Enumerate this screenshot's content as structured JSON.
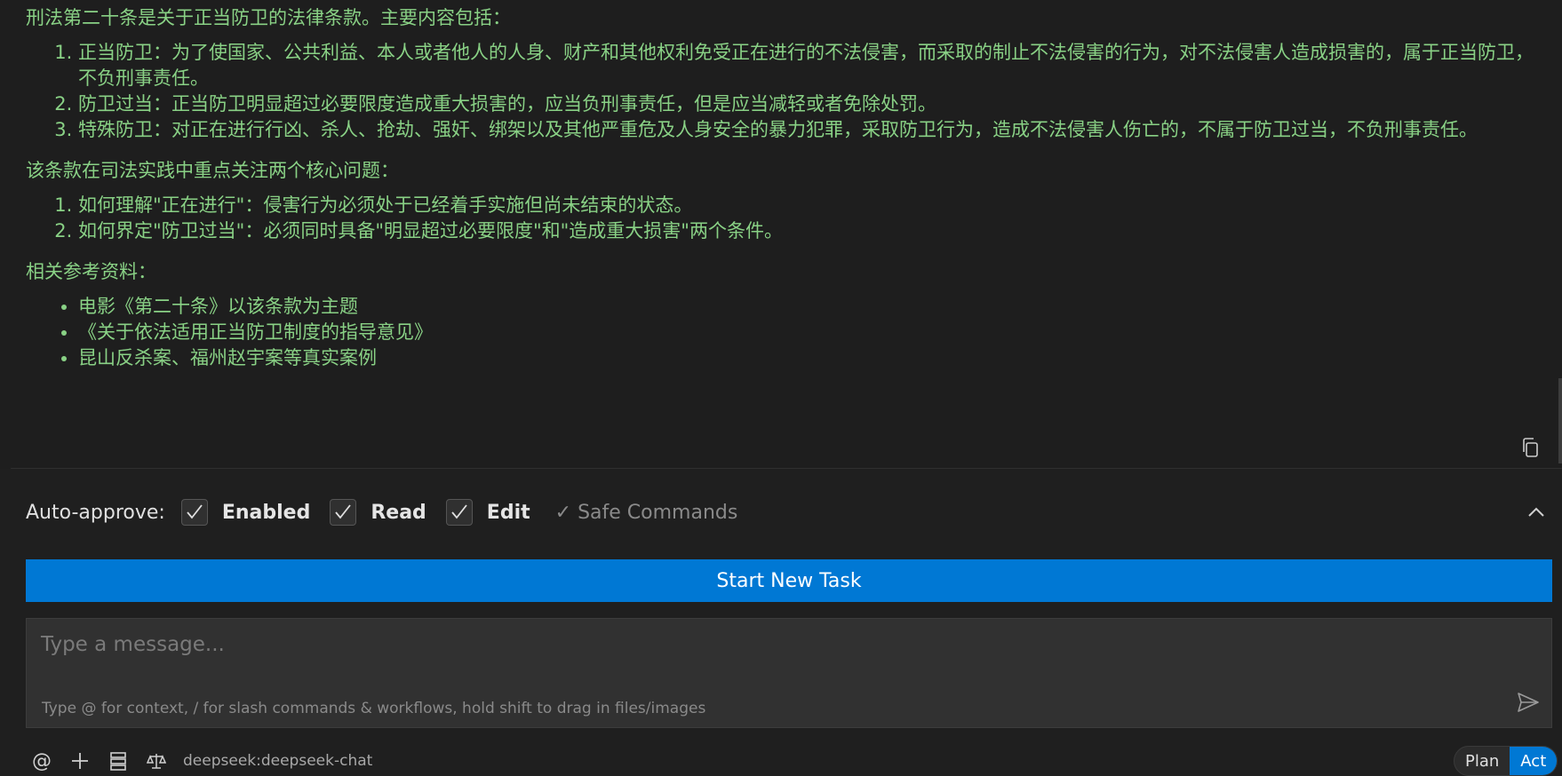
{
  "answer": {
    "intro": "刑法第二十条是关于正当防卫的法律条款。主要内容包括：",
    "main_points": [
      "正当防卫：为了使国家、公共利益、本人或者他人的人身、财产和其他权利免受正在进行的不法侵害，而采取的制止不法侵害的行为，对不法侵害人造成损害的，属于正当防卫，不负刑事责任。",
      "防卫过当：正当防卫明显超过必要限度造成重大损害的，应当负刑事责任，但是应当减轻或者免除处罚。",
      "特殊防卫：对正在进行行凶、杀人、抢劫、强奸、绑架以及其他严重危及人身安全的暴力犯罪，采取防卫行为，造成不法侵害人伤亡的，不属于防卫过当，不负刑事责任。"
    ],
    "practice_heading": "该条款在司法实践中重点关注两个核心问题：",
    "practice_points": [
      "如何理解\"正在进行\"：侵害行为必须处于已经着手实施但尚未结束的状态。",
      "如何界定\"防卫过当\"：必须同时具备\"明显超过必要限度\"和\"造成重大损害\"两个条件。"
    ],
    "refs_heading": "相关参考资料：",
    "refs": [
      "电影《第二十条》以该条款为主题",
      "《关于依法适用正当防卫制度的指导意见》",
      "昆山反杀案、福州赵宇案等真实案例"
    ]
  },
  "auto_approve": {
    "label": "Auto-approve:",
    "items": [
      {
        "label": "Enabled",
        "checked": true
      },
      {
        "label": "Read",
        "checked": true
      },
      {
        "label": "Edit",
        "checked": true
      }
    ],
    "safe_commands": "✓ Safe Commands"
  },
  "new_task_label": "Start New Task",
  "input": {
    "placeholder": "Type a message...",
    "hint": "Type @ for context, / for slash commands & workflows, hold shift to drag in files/images"
  },
  "toolbar": {
    "model": "deepseek:deepseek-chat",
    "icons": [
      "at-icon",
      "plus-icon",
      "server-icon",
      "scale-icon"
    ]
  },
  "mode_toggle": {
    "plan": "Plan",
    "act": "Act",
    "active": "Act"
  },
  "colors": {
    "answer_text": "#89d185",
    "accent": "#0078d4",
    "background": "#1f1f1f"
  }
}
